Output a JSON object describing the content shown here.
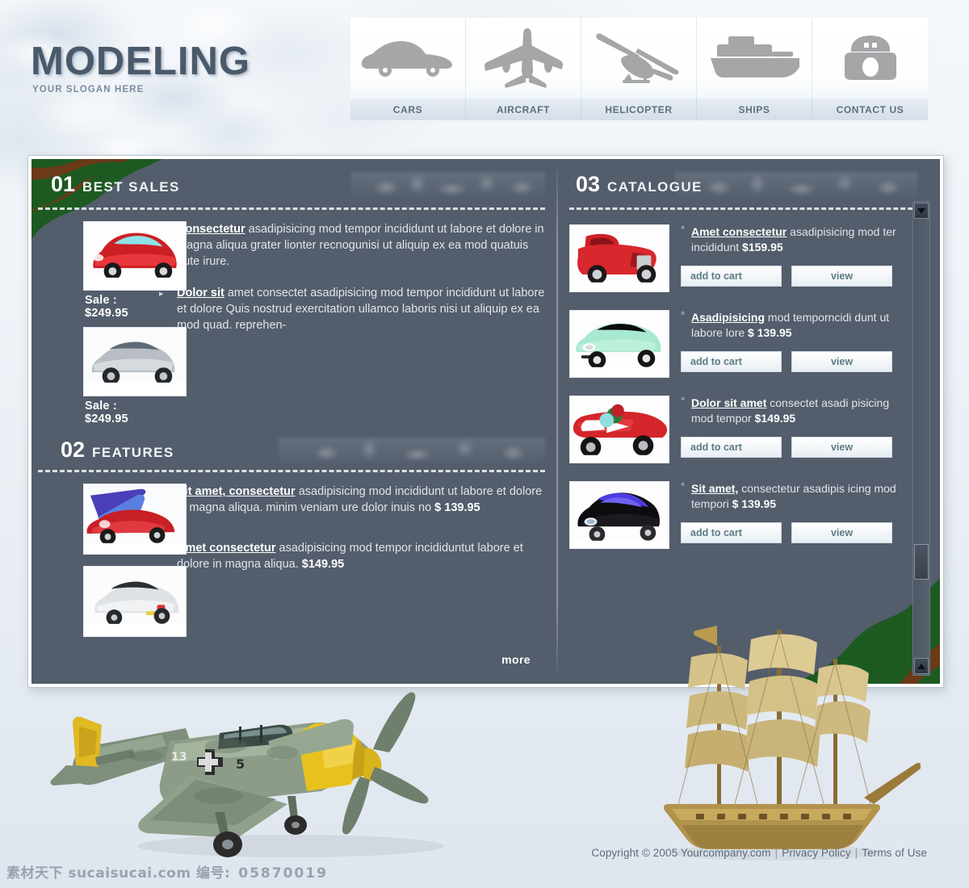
{
  "brand": {
    "title": "MODELING",
    "slogan": "YOUR SLOGAN HERE"
  },
  "nav": {
    "items": [
      {
        "label": "CARS",
        "icon": "car-icon"
      },
      {
        "label": "AIRCRAFT",
        "icon": "airplane-icon"
      },
      {
        "label": "HELICOPTER",
        "icon": "helicopter-icon"
      },
      {
        "label": "SHIPS",
        "icon": "ship-icon"
      },
      {
        "label": "CONTACT US",
        "icon": "telephone-icon"
      }
    ]
  },
  "best_sales": {
    "number": "01",
    "title": "BEST SALES",
    "products": [
      {
        "sale_label": "Sale : $249.95",
        "image": "red-sports-car-thumb"
      },
      {
        "sale_label": "Sale : $249.95",
        "image": "silver-sedan-thumb"
      }
    ],
    "items": [
      {
        "lead": "Consectetur",
        "body": " asadipisicing  mod tempor incididunt ut labore et dolore in magna aliqua grater lionter recnogunisi ut aliquip ex ea mod quatuis aute irure."
      },
      {
        "lead": "Dolor sit",
        "body": " amet consectet asadipisicing  mod tempor incididunt ut labore et dolore Quis nostrud exercitation ullamco laboris nisi ut aliquip ex ea mod quad.          reprehen-"
      }
    ]
  },
  "features": {
    "number": "02",
    "title": "FEATURES",
    "products": [
      {
        "image": "red-concept-car-thumb"
      },
      {
        "image": "white-convertible-thumb"
      }
    ],
    "items": [
      {
        "lead": "Sit amet, consectetur",
        "body": " asadipisicing  mod incididunt ut labore et dolore in magna aliqua. minim veniam ure dolor inuis no ",
        "price": "$ 139.95"
      },
      {
        "lead": "Amet  consectetur",
        "body": " asadipisicing  mod tempor incididuntut labore et dolore in magna aliqua. ",
        "price": "$149.95"
      }
    ],
    "more_label": "more"
  },
  "catalogue": {
    "number": "03",
    "title": "CATALOGUE",
    "add_to_cart_label": "add to cart",
    "view_label": "view",
    "items": [
      {
        "image": "red-hotrod-thumb",
        "lead": "Amet  consectetur",
        "body": " asadipisicing mod ter incididunt ",
        "price": "$159.95"
      },
      {
        "image": "mint-sports-car-thumb",
        "lead": "Asadipisicing",
        "body": "  mod temporncidi dunt ut labore lore ",
        "price": "$ 139.95"
      },
      {
        "image": "red-race-car-thumb",
        "lead": "Dolor sit amet",
        "body": " consectet asadi pisicing  mod tempor ",
        "price": "$149.95"
      },
      {
        "image": "black-blue-car-thumb",
        "lead": "Sit amet,",
        "body": " consectetur asadipis icing  mod tempori ",
        "price": "$ 139.95"
      }
    ]
  },
  "footer": {
    "copyright": "Copyright © 2005 Yourcompany.com",
    "privacy": "Privacy Policy",
    "terms": "Terms of Use"
  },
  "watermark": {
    "site": "素材天下 sucaisucai.com  编号:",
    "number": "05870019"
  },
  "colors": {
    "panel_bg": "#535d6b",
    "nav_label_bg": "#dde6ee",
    "camo_green": "#1d5a22",
    "camo_brown": "#6b3a19",
    "logo": "#4a5a6b"
  }
}
